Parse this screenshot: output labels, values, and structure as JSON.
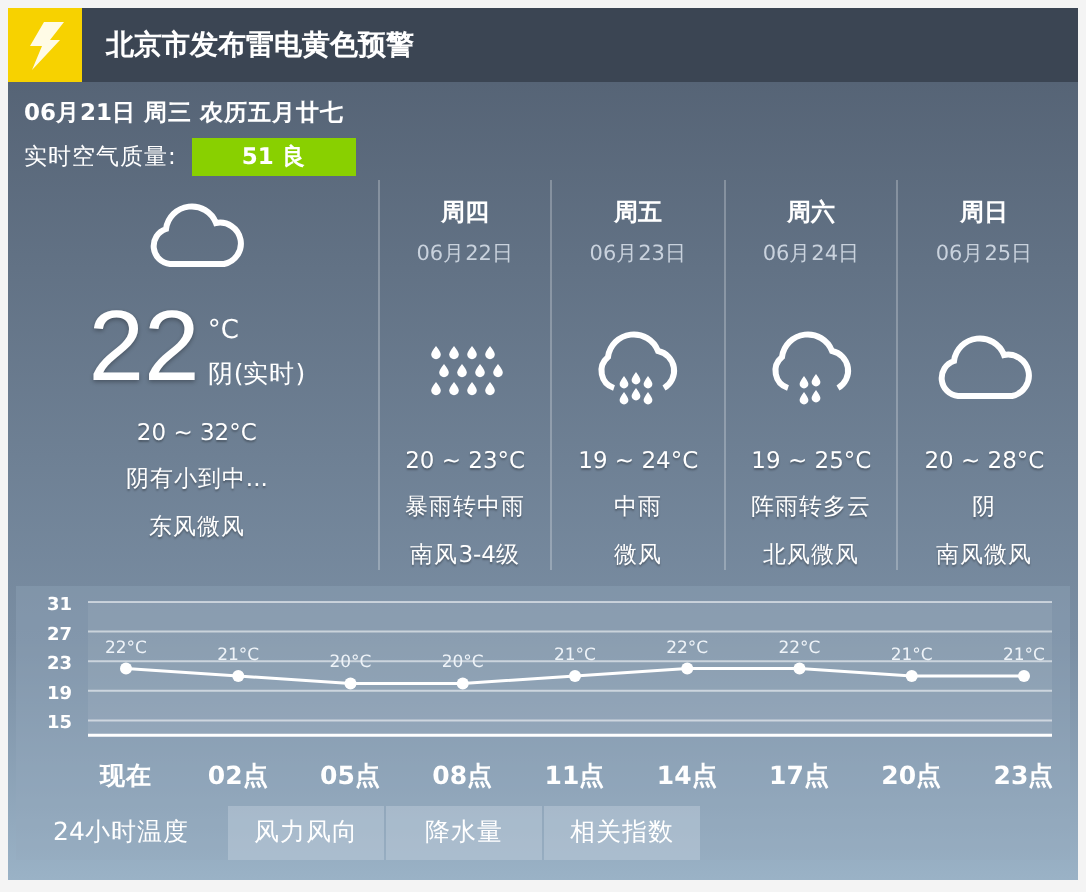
{
  "alert": {
    "title": "北京市发布雷电黄色预警"
  },
  "date_line": "06月21日 周三 农历五月廿七",
  "air_quality": {
    "label": "实时空气质量:",
    "value": "51 良"
  },
  "today": {
    "kind": "cloudy",
    "temp": "22",
    "unit": "°C",
    "desc": "阴(实时)",
    "range": "20 ~ 32°C",
    "weather": "阴有小到中...",
    "wind": "东风微风"
  },
  "days": [
    {
      "weekday": "周四",
      "date": "06月22日",
      "kind": "heavy_rain",
      "range": "20 ~ 23°C",
      "weather": "暴雨转中雨",
      "wind": "南风3-4级"
    },
    {
      "weekday": "周五",
      "date": "06月23日",
      "kind": "rain",
      "range": "19 ~ 24°C",
      "weather": "中雨",
      "wind": "微风"
    },
    {
      "weekday": "周六",
      "date": "06月24日",
      "kind": "shower",
      "range": "19 ~ 25°C",
      "weather": "阵雨转多云",
      "wind": "北风微风"
    },
    {
      "weekday": "周日",
      "date": "06月25日",
      "kind": "cloudy",
      "range": "20 ~ 28°C",
      "weather": "阴",
      "wind": "南风微风"
    }
  ],
  "hourly": {
    "chart_data": {
      "type": "line",
      "categories": [
        "现在",
        "02点",
        "05点",
        "08点",
        "11点",
        "14点",
        "17点",
        "20点",
        "23点"
      ],
      "series": [
        {
          "color": "#ffffff",
          "marker": "circle",
          "values": [
            22,
            21,
            20,
            20,
            21,
            22,
            22,
            21,
            21
          ]
        }
      ],
      "grid": true,
      "value_labels": [
        "22°C",
        "21°C",
        "20°C",
        "20°C",
        "21°C",
        "22°C",
        "22°C",
        "21°C",
        "21°C"
      ],
      "yticks": [
        15,
        19,
        23,
        27,
        31
      ],
      "ylim": [
        13,
        31
      ]
    }
  },
  "tabs": [
    {
      "label": "24小时温度",
      "selected": true
    },
    {
      "label": "风力风向",
      "selected": false
    },
    {
      "label": "降水量",
      "selected": false
    },
    {
      "label": "相关指数",
      "selected": false
    }
  ]
}
